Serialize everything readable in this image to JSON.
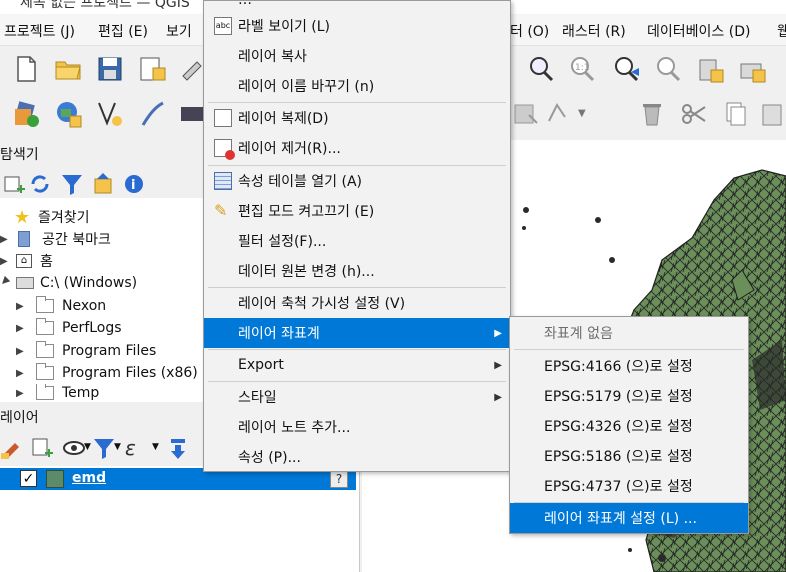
{
  "window": {
    "title_fragment": "제목 없는 프로젝트 — QGIS"
  },
  "menubar": {
    "items": [
      "프로젝트 (J)",
      "편집 (E)",
      "보기",
      "터 (O)",
      "래스터 (R)",
      "데이터베이스 (D)",
      "웹"
    ]
  },
  "browser": {
    "title": "탐색기",
    "items": [
      {
        "label": "즐겨찾기",
        "icon": "star-icon"
      },
      {
        "label": "공간 북마크",
        "icon": "bookmark-icon"
      },
      {
        "label": "홈",
        "icon": "home-icon"
      },
      {
        "label": "C:\\ (Windows)",
        "icon": "drive-icon"
      },
      {
        "label": "Nexon",
        "icon": "folder-icon"
      },
      {
        "label": "PerfLogs",
        "icon": "folder-icon"
      },
      {
        "label": "Program Files",
        "icon": "folder-icon"
      },
      {
        "label": "Program Files (x86)",
        "icon": "folder-icon"
      },
      {
        "label": "Temp",
        "icon": "folder-icon"
      }
    ]
  },
  "layers": {
    "title": "레이어",
    "rows": [
      {
        "name": "emd",
        "checked": true
      }
    ]
  },
  "context_menu": {
    "items": [
      {
        "label": "라벨 보이기 (L)",
        "icon": "label-icon"
      },
      {
        "label": "레이어 복사"
      },
      {
        "label": "레이어 이름 바꾸기 (n)"
      },
      {
        "sep": true
      },
      {
        "label": "레이어 복제(D)",
        "icon": "duplicate-icon"
      },
      {
        "label": "레이어 제거(R)...",
        "icon": "remove-icon"
      },
      {
        "sep": true
      },
      {
        "label": "속성 테이블 열기 (A)",
        "icon": "table-icon"
      },
      {
        "label": "편집 모드 켜고끄기 (E)",
        "icon": "pencil-icon"
      },
      {
        "label": "필터 설정(F)..."
      },
      {
        "label": "데이터 원본 변경 (h)..."
      },
      {
        "sep": true
      },
      {
        "label": "레이어 축척 가시성 설정 (V)"
      },
      {
        "label": "레이어 좌표계",
        "submenu": true,
        "highlighted": true
      },
      {
        "sep": true
      },
      {
        "label": "Export",
        "submenu": true
      },
      {
        "sep": true
      },
      {
        "label": "스타일",
        "submenu": true
      },
      {
        "label": "레이어 노트 추가..."
      },
      {
        "label": "속성 (P)..."
      }
    ]
  },
  "crs_submenu": {
    "items": [
      {
        "label": "좌표계 없음",
        "disabled": true
      },
      {
        "sep": true
      },
      {
        "label": "EPSG:4166 (으)로 설정"
      },
      {
        "label": "EPSG:5179 (으)로 설정"
      },
      {
        "label": "EPSG:4326 (으)로 설정"
      },
      {
        "label": "EPSG:5186 (으)로 설정"
      },
      {
        "label": "EPSG:4737 (으)로 설정"
      },
      {
        "sep": true
      },
      {
        "label": "레이어 좌표계 설정 (L) ...",
        "highlighted": true
      }
    ]
  },
  "colors": {
    "accent": "#0078d7",
    "polygon_fill": "#6a8f5a",
    "polygon_stroke": "#2a2a2a"
  }
}
